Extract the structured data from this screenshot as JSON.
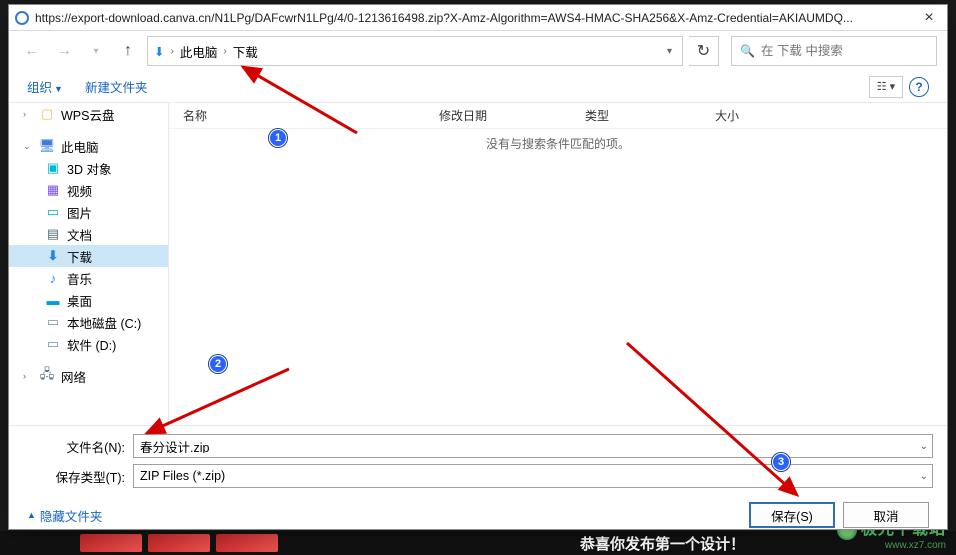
{
  "titlebar": {
    "url": "https://export-download.canva.cn/N1LPg/DAFcwrN1LPg/4/0-1213616498.zip?X-Amz-Algorithm=AWS4-HMAC-SHA256&X-Amz-Credential=AKIAUMDQ...",
    "close": "×"
  },
  "breadcrumb": {
    "seg1": "此电脑",
    "seg2": "下载"
  },
  "search": {
    "placeholder": "在 下载 中搜索"
  },
  "toolbar": {
    "organize": "组织",
    "newfolder": "新建文件夹",
    "help": "?"
  },
  "tree": {
    "wps": "WPS云盘",
    "pc": "此电脑",
    "obj3d": "3D 对象",
    "video": "视频",
    "pic": "图片",
    "doc": "文档",
    "dl": "下载",
    "music": "音乐",
    "desk": "桌面",
    "diskc": "本地磁盘 (C:)",
    "diskd": "软件 (D:)",
    "net": "网络"
  },
  "columns": {
    "name": "名称",
    "date": "修改日期",
    "type": "类型",
    "size": "大小"
  },
  "empty_msg": "没有与搜索条件匹配的项。",
  "form": {
    "filename_label": "文件名(N):",
    "filename_value": "春分设计.zip",
    "filetype_label": "保存类型(T):",
    "filetype_value": "ZIP Files (*.zip)"
  },
  "footer": {
    "hide": "隐藏文件夹",
    "save": "保存(S)",
    "cancel": "取消"
  },
  "annotations": {
    "n1": "1",
    "n2": "2",
    "n3": "3"
  },
  "bg": {
    "congrats": "恭喜你发布第一个设计！",
    "brand": "极光下载站",
    "brand_url": "www.xz7.com"
  }
}
